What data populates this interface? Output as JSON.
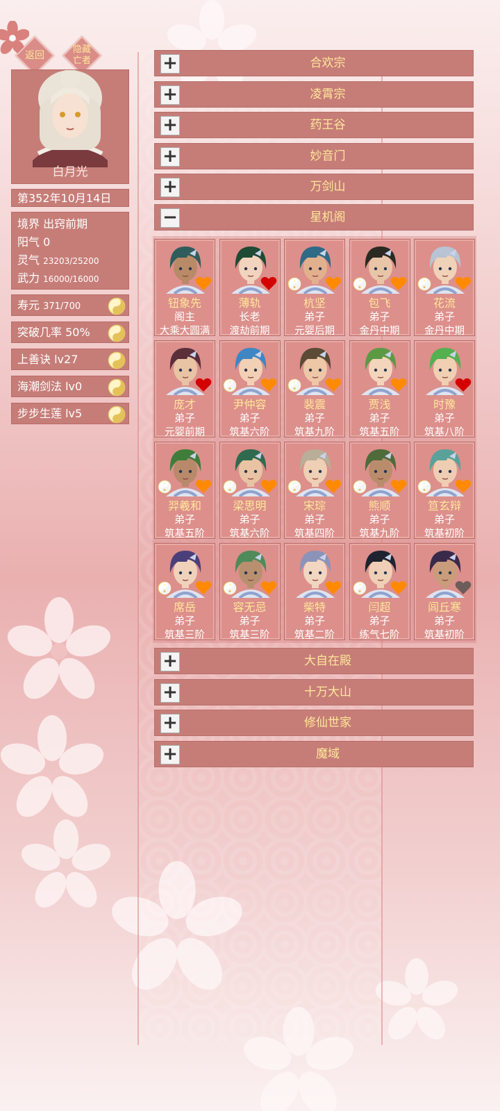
{
  "nav": {
    "back_label": "返回",
    "hide_dead_label": "隐藏\n亡者"
  },
  "player": {
    "name": "白月光",
    "date": "第352年10月14日",
    "realm_label": "境界",
    "realm_value": "出窍前期",
    "yang_label": "阳气",
    "yang_value": "0",
    "spirit_label": "灵气",
    "spirit_value": "23203/25200",
    "force_label": "武力",
    "force_value": "16000/16000"
  },
  "traits": [
    {
      "label": "寿元",
      "value": "371/700"
    },
    {
      "label": "突破几率",
      "value": "50%"
    },
    {
      "label": "上善诀",
      "value": "lv27"
    },
    {
      "label": "海潮剑法",
      "value": "lv0"
    },
    {
      "label": "步步生莲",
      "value": "lv5"
    }
  ],
  "sects_top": [
    "合欢宗",
    "凌霄宗",
    "药王谷",
    "妙音门",
    "万剑山"
  ],
  "expanded_sect": "星机阁",
  "sects_bottom": [
    "大自在殿",
    "十万大山",
    "修仙世家",
    "魔域"
  ],
  "toggle_collapsed": "+",
  "toggle_expanded": "−",
  "members": [
    {
      "name": "钮象先",
      "role": "阁主",
      "realm": "大乘大圆满",
      "hair": "#2f5d5b",
      "skin": "#b98a67",
      "heart": "orange",
      "yinyang": false
    },
    {
      "name": "薄轨",
      "role": "长老",
      "realm": "渡劫前期",
      "hair": "#1f4a35",
      "skin": "#f2d3bd",
      "heart": "red",
      "yinyang": false
    },
    {
      "name": "杭坚",
      "role": "弟子",
      "realm": "元婴后期",
      "hair": "#2f6a86",
      "skin": "#e2b08d",
      "heart": "orange",
      "yinyang": true
    },
    {
      "name": "包飞",
      "role": "弟子",
      "realm": "金丹中期",
      "hair": "#2b2a22",
      "skin": "#e9c5a7",
      "heart": "orange",
      "yinyang": true
    },
    {
      "name": "花流",
      "role": "弟子",
      "realm": "金丹中期",
      "hair": "#b8c3d3",
      "skin": "#f0d2b8",
      "heart": "orange",
      "yinyang": true
    },
    {
      "name": "庞才",
      "role": "弟子",
      "realm": "元婴前期",
      "hair": "#5a2f3a",
      "skin": "#e8c3a4",
      "heart": "red",
      "yinyang": false
    },
    {
      "name": "尹仲容",
      "role": "弟子",
      "realm": "筑基六阶",
      "hair": "#3f86c4",
      "skin": "#f2d0b6",
      "heart": "orange",
      "yinyang": true
    },
    {
      "name": "裴震",
      "role": "弟子",
      "realm": "筑基九阶",
      "hair": "#5a4a36",
      "skin": "#edc7a6",
      "heart": "orange",
      "yinyang": true
    },
    {
      "name": "贾浅",
      "role": "弟子",
      "realm": "筑基五阶",
      "hair": "#5b9a43",
      "skin": "#f3d5bc",
      "heart": "orange",
      "yinyang": false
    },
    {
      "name": "时豫",
      "role": "弟子",
      "realm": "筑基八阶",
      "hair": "#55b04f",
      "skin": "#f0cfb2",
      "heart": "red",
      "yinyang": false
    },
    {
      "name": "羿羲和",
      "role": "弟子",
      "realm": "筑基五阶",
      "hair": "#3e7d3a",
      "skin": "#b8896a",
      "heart": "orange",
      "yinyang": true
    },
    {
      "name": "梁思明",
      "role": "弟子",
      "realm": "筑基六阶",
      "hair": "#2f6a4f",
      "skin": "#e9c4a4",
      "heart": "orange",
      "yinyang": true
    },
    {
      "name": "宋琮",
      "role": "弟子",
      "realm": "筑基四阶",
      "hair": "#b9ae98",
      "skin": "#efcfb5",
      "heart": "orange",
      "yinyang": true
    },
    {
      "name": "熊顺",
      "role": "弟子",
      "realm": "筑基九阶",
      "hair": "#4f6b3a",
      "skin": "#b98d6c",
      "heart": "orange",
      "yinyang": true
    },
    {
      "name": "笪玄辩",
      "role": "弟子",
      "realm": "筑基初阶",
      "hair": "#5aa19a",
      "skin": "#eecdb3",
      "heart": "orange",
      "yinyang": true
    },
    {
      "name": "席岳",
      "role": "弟子",
      "realm": "筑基三阶",
      "hair": "#4a3f7a",
      "skin": "#f0d2bb",
      "heart": "orange",
      "yinyang": true
    },
    {
      "name": "容无忌",
      "role": "弟子",
      "realm": "筑基三阶",
      "hair": "#4f8a5a",
      "skin": "#b8906f",
      "heart": "orange",
      "yinyang": true
    },
    {
      "name": "柴特",
      "role": "弟子",
      "realm": "筑基二阶",
      "hair": "#8c93b9",
      "skin": "#f1d6c1",
      "heart": "orange",
      "yinyang": false
    },
    {
      "name": "闫超",
      "role": "弟子",
      "realm": "练气七阶",
      "hair": "#1f2330",
      "skin": "#efd0b6",
      "heart": "orange",
      "yinyang": true
    },
    {
      "name": "闾丘寒",
      "role": "弟子",
      "realm": "筑基初阶",
      "hair": "#3a2a4a",
      "skin": "#c99d7b",
      "heart": "gray",
      "yinyang": false
    }
  ],
  "colors": {
    "accent_text": "#ffe79a",
    "panel": "#c67d78",
    "heart_orange": "#ff8a00",
    "heart_red": "#d40000",
    "heart_gray": "#6d5d5a"
  }
}
